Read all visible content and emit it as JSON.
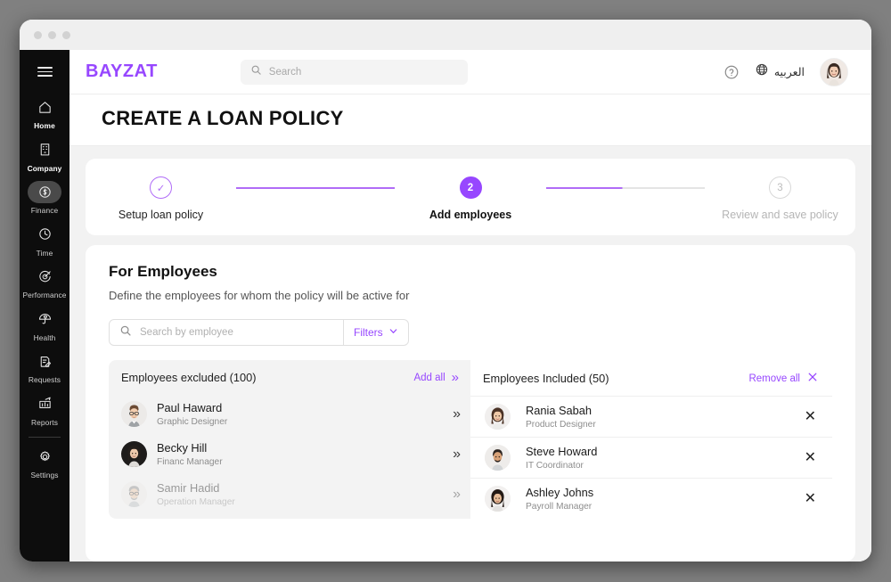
{
  "window": {
    "traffic_lights": 3
  },
  "sidebar": {
    "menu_icon": "hamburger-icon",
    "items": [
      {
        "label": "Home",
        "icon": "home-icon",
        "active": false,
        "strong": true
      },
      {
        "label": "Company",
        "icon": "building-icon",
        "active": false,
        "strong": true
      },
      {
        "label": "Finance",
        "icon": "dollar-circle-icon",
        "active": true,
        "strong": false
      },
      {
        "label": "Time",
        "icon": "clock-icon",
        "active": false,
        "strong": false
      },
      {
        "label": "Performance",
        "icon": "target-icon",
        "active": false,
        "strong": false
      },
      {
        "label": "Health",
        "icon": "umbrella-heart-icon",
        "active": false,
        "strong": false
      },
      {
        "label": "Requests",
        "icon": "clipboard-edit-icon",
        "active": false,
        "strong": false
      },
      {
        "label": "Reports",
        "icon": "bar-chart-icon",
        "active": false,
        "strong": false
      },
      {
        "label": "Settings",
        "icon": "gear-icon",
        "active": false,
        "strong": false
      }
    ]
  },
  "topbar": {
    "logo": "BAYZAT",
    "search": {
      "value": "",
      "placeholder": "Search",
      "icon": "search-icon"
    },
    "help_icon": "question-circle-icon",
    "language": {
      "label": "العربيه",
      "icon": "globe-icon"
    },
    "avatar": "user-avatar"
  },
  "header": {
    "title": "CREATE A LOAN POLICY"
  },
  "stepper": {
    "steps": [
      {
        "number": "1",
        "marker": "✓",
        "label": "Setup loan policy",
        "state": "done"
      },
      {
        "number": "2",
        "marker": "2",
        "label": "Add employees",
        "state": "active"
      },
      {
        "number": "3",
        "marker": "3",
        "label": "Review and save policy",
        "state": "todo"
      }
    ]
  },
  "employees_section": {
    "title": "For Employees",
    "subtitle": "Define the employees for whom the policy will be active for",
    "search": {
      "value": "",
      "placeholder": "Search by employee",
      "icon": "search-icon"
    },
    "filters_label": "Filters",
    "filters_icon": "chevron-down-icon",
    "excluded": {
      "title": "Employees excluded (100)",
      "action_label": "Add all",
      "action_icon": "double-chevron-right-icon",
      "rows": [
        {
          "name": "Paul Haward",
          "role": "Graphic Designer",
          "action_icon": "double-chevron-right-icon",
          "faded": false
        },
        {
          "name": "Becky Hill",
          "role": "Financ Manager",
          "action_icon": "double-chevron-right-icon",
          "faded": false
        },
        {
          "name": "Samir Hadid",
          "role": "Operation Manager",
          "action_icon": "double-chevron-right-icon",
          "faded": true
        }
      ]
    },
    "included": {
      "title": "Employees Included (50)",
      "action_label": "Remove all",
      "action_icon": "close-icon",
      "rows": [
        {
          "name": "Rania Sabah",
          "role": "Product Designer",
          "action_icon": "close-icon",
          "faded": false
        },
        {
          "name": "Steve Howard",
          "role": "IT Coordinator",
          "action_icon": "close-icon",
          "faded": false
        },
        {
          "name": "Ashley Johns",
          "role": "Payroll Manager",
          "action_icon": "close-icon",
          "faded": false
        }
      ]
    }
  },
  "colors": {
    "brand_purple": "#9747ff",
    "step_line": "#b06cf7",
    "sidebar_bg": "#0d0d0d",
    "page_bg": "#f2f2f2",
    "panel_gray": "#f3f3f3"
  }
}
